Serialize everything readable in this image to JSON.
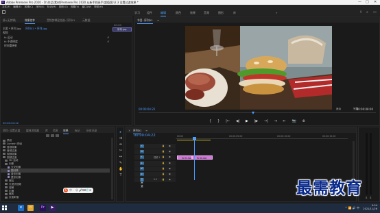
{
  "window": {
    "title": "Adobe Premiere Pro 2020 - D:\\作品\\素材\\Premiere Pro 2020 从新手到高手(超值版)\\2.3 设置过渡效果 *",
    "logo_text": "Pr",
    "controls": [
      "—",
      "□",
      "✕"
    ]
  },
  "menu": [
    "文件(F)",
    "编辑(E)",
    "剪辑(C)",
    "序列(S)",
    "标记(M)",
    "图形(G)",
    "视图(V)",
    "窗口(W)",
    "帮助(H)"
  ],
  "workspaces": {
    "tabs": [
      "学习",
      "组件",
      "编辑",
      "颜色",
      "效果",
      "音频",
      "图形",
      "库"
    ],
    "active": "编辑",
    "overflow": "»"
  },
  "effect_controls": {
    "tabs": [
      "源:(无剪辑)",
      "效果控件",
      "音频剪辑混合器: 序列01",
      "元数据"
    ],
    "active_tab": "效果控件",
    "source": "主要 * 序列.jpg",
    "sequence": "序列01 * 序列.jpg",
    "clip_label": "序列.jpg",
    "timecode_top": "00:00",
    "sections": [
      "视频",
      "fx 运动",
      "fx 不透明度",
      "时间重映射"
    ],
    "timecode": "00:00:04:22"
  },
  "program_monitor": {
    "title": "节目: 序列01",
    "menu_icon": "≡",
    "timecode_left": "00:00:04:22",
    "fit": "适合",
    "quality": "完整",
    "timecode_right": "00:00:08:00",
    "transport": [
      "{",
      "}",
      "|←",
      "◀|",
      "▶",
      "|▶",
      "→|",
      "⇥",
      "⇤",
      "📷",
      "⊕"
    ]
  },
  "project": {
    "tabs": [
      "项目: 设置过渡",
      "媒体浏览器",
      "库",
      "信息",
      "效果",
      "标记",
      "历史记录"
    ],
    "active_tab": "效果",
    "tree": [
      {
        "label": "预设",
        "level": 0,
        "folder": true
      },
      {
        "label": "Lumetri 预设",
        "level": 0,
        "folder": true
      },
      {
        "label": "音频效果",
        "level": 0,
        "folder": true
      },
      {
        "label": "音频过渡",
        "level": 0,
        "folder": true
      },
      {
        "label": "视频效果",
        "level": 0,
        "folder": true
      },
      {
        "label": "视频过渡",
        "level": 0,
        "folder": true
      },
      {
        "label": "3D 运动",
        "level": 1,
        "folder": true
      },
      {
        "label": "划像",
        "level": 1,
        "folder": true
      },
      {
        "label": "交叉划像",
        "level": 2,
        "folder": false
      },
      {
        "label": "圆划像",
        "level": 2,
        "folder": false,
        "selected": true
      },
      {
        "label": "盒形划像",
        "level": 2,
        "folder": false
      },
      {
        "label": "菱形划像",
        "level": 2,
        "folder": false
      },
      {
        "label": "擦除",
        "level": 1,
        "folder": true
      },
      {
        "label": "沉浸式视频",
        "level": 1,
        "folder": true
      },
      {
        "label": "溶解",
        "level": 1,
        "folder": true
      },
      {
        "label": "内滑",
        "level": 1,
        "folder": true
      },
      {
        "label": "缩放",
        "level": 1,
        "folder": true
      },
      {
        "label": "页面剥落",
        "level": 1,
        "folder": true
      }
    ]
  },
  "tools": [
    "select-tool",
    "track-select-tool",
    "ripple-tool",
    "razor-tool",
    "slip-tool",
    "pen-tool",
    "hand-tool",
    "type-tool"
  ],
  "tool_glyphs": [
    "▸",
    "⇉",
    "⇹",
    "✂",
    "↔",
    "✎",
    "✋",
    "T"
  ],
  "timeline": {
    "title": "序列01",
    "menu_icon": "≡",
    "timecode": "00:00:04:22",
    "ruler": [
      "00:00",
      "00:00:05:00",
      "00:00:10:00",
      "00:00:15:00"
    ],
    "tracks": [
      {
        "id": "V3",
        "name": ""
      },
      {
        "id": "V2",
        "name": ""
      },
      {
        "id": "V1",
        "name": "视频 1"
      },
      {
        "id": "A1",
        "name": ""
      },
      {
        "id": "A2",
        "name": ""
      },
      {
        "id": "A3",
        "name": ""
      },
      {
        "id": "主声道",
        "name": "0.0"
      }
    ],
    "clips": [
      {
        "label": "fx 01.jpg",
        "track": "V1"
      },
      {
        "label": "fx 02.jpg",
        "track": "V1"
      }
    ]
  },
  "meters": {
    "labels": [
      "S",
      "S"
    ]
  },
  "watermark": "最需教育",
  "ime": {
    "letter": "S",
    "glyphs": [
      "中",
      "·",
      "☺",
      "🎤",
      "⌨",
      "👕",
      "⊞"
    ]
  },
  "taskbar": {
    "apps": [
      "edge",
      "explorer",
      "premiere",
      "media"
    ],
    "time": "9:54",
    "date": "2021/11/26",
    "tray": "^ 📶 🔊 中"
  }
}
